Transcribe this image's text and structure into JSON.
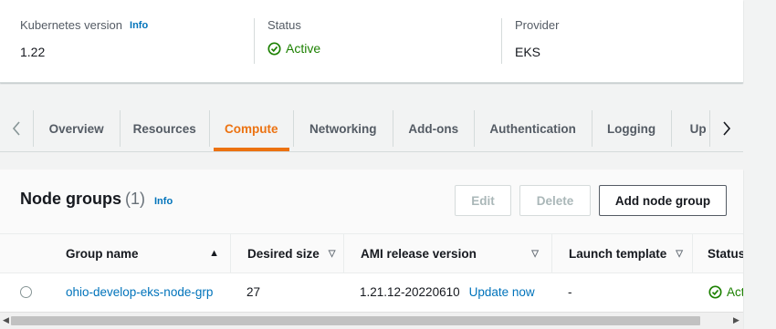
{
  "details": {
    "kubernetes": {
      "label": "Kubernetes version",
      "info": "Info",
      "value": "1.22"
    },
    "status": {
      "label": "Status",
      "value": "Active"
    },
    "provider": {
      "label": "Provider",
      "value": "EKS"
    }
  },
  "tabs": [
    {
      "label": "Overview",
      "active": false
    },
    {
      "label": "Resources",
      "active": false
    },
    {
      "label": "Compute",
      "active": true
    },
    {
      "label": "Networking",
      "active": false
    },
    {
      "label": "Add-ons",
      "active": false
    },
    {
      "label": "Authentication",
      "active": false
    },
    {
      "label": "Logging",
      "active": false
    },
    {
      "label": "Up",
      "active": false
    }
  ],
  "node_groups": {
    "title": "Node groups",
    "count": "(1)",
    "info": "Info",
    "buttons": {
      "edit": "Edit",
      "delete": "Delete",
      "add": "Add node group"
    },
    "columns": [
      {
        "label": "Group name",
        "sort": "▲"
      },
      {
        "label": "Desired size",
        "sort": "▽"
      },
      {
        "label": "AMI release version",
        "sort": "▽"
      },
      {
        "label": "Launch template",
        "sort": "▽"
      },
      {
        "label": "Status",
        "sort": ""
      }
    ],
    "rows": [
      {
        "name": "ohio-develop-eks-node-grp",
        "desired": "27",
        "ami": "1.21.12-20220610",
        "ami_action": "Update now",
        "launch": "-",
        "status": "Act"
      }
    ]
  },
  "colors": {
    "accent": "#ec7211",
    "link": "#0073bb",
    "success": "#1d8102"
  }
}
